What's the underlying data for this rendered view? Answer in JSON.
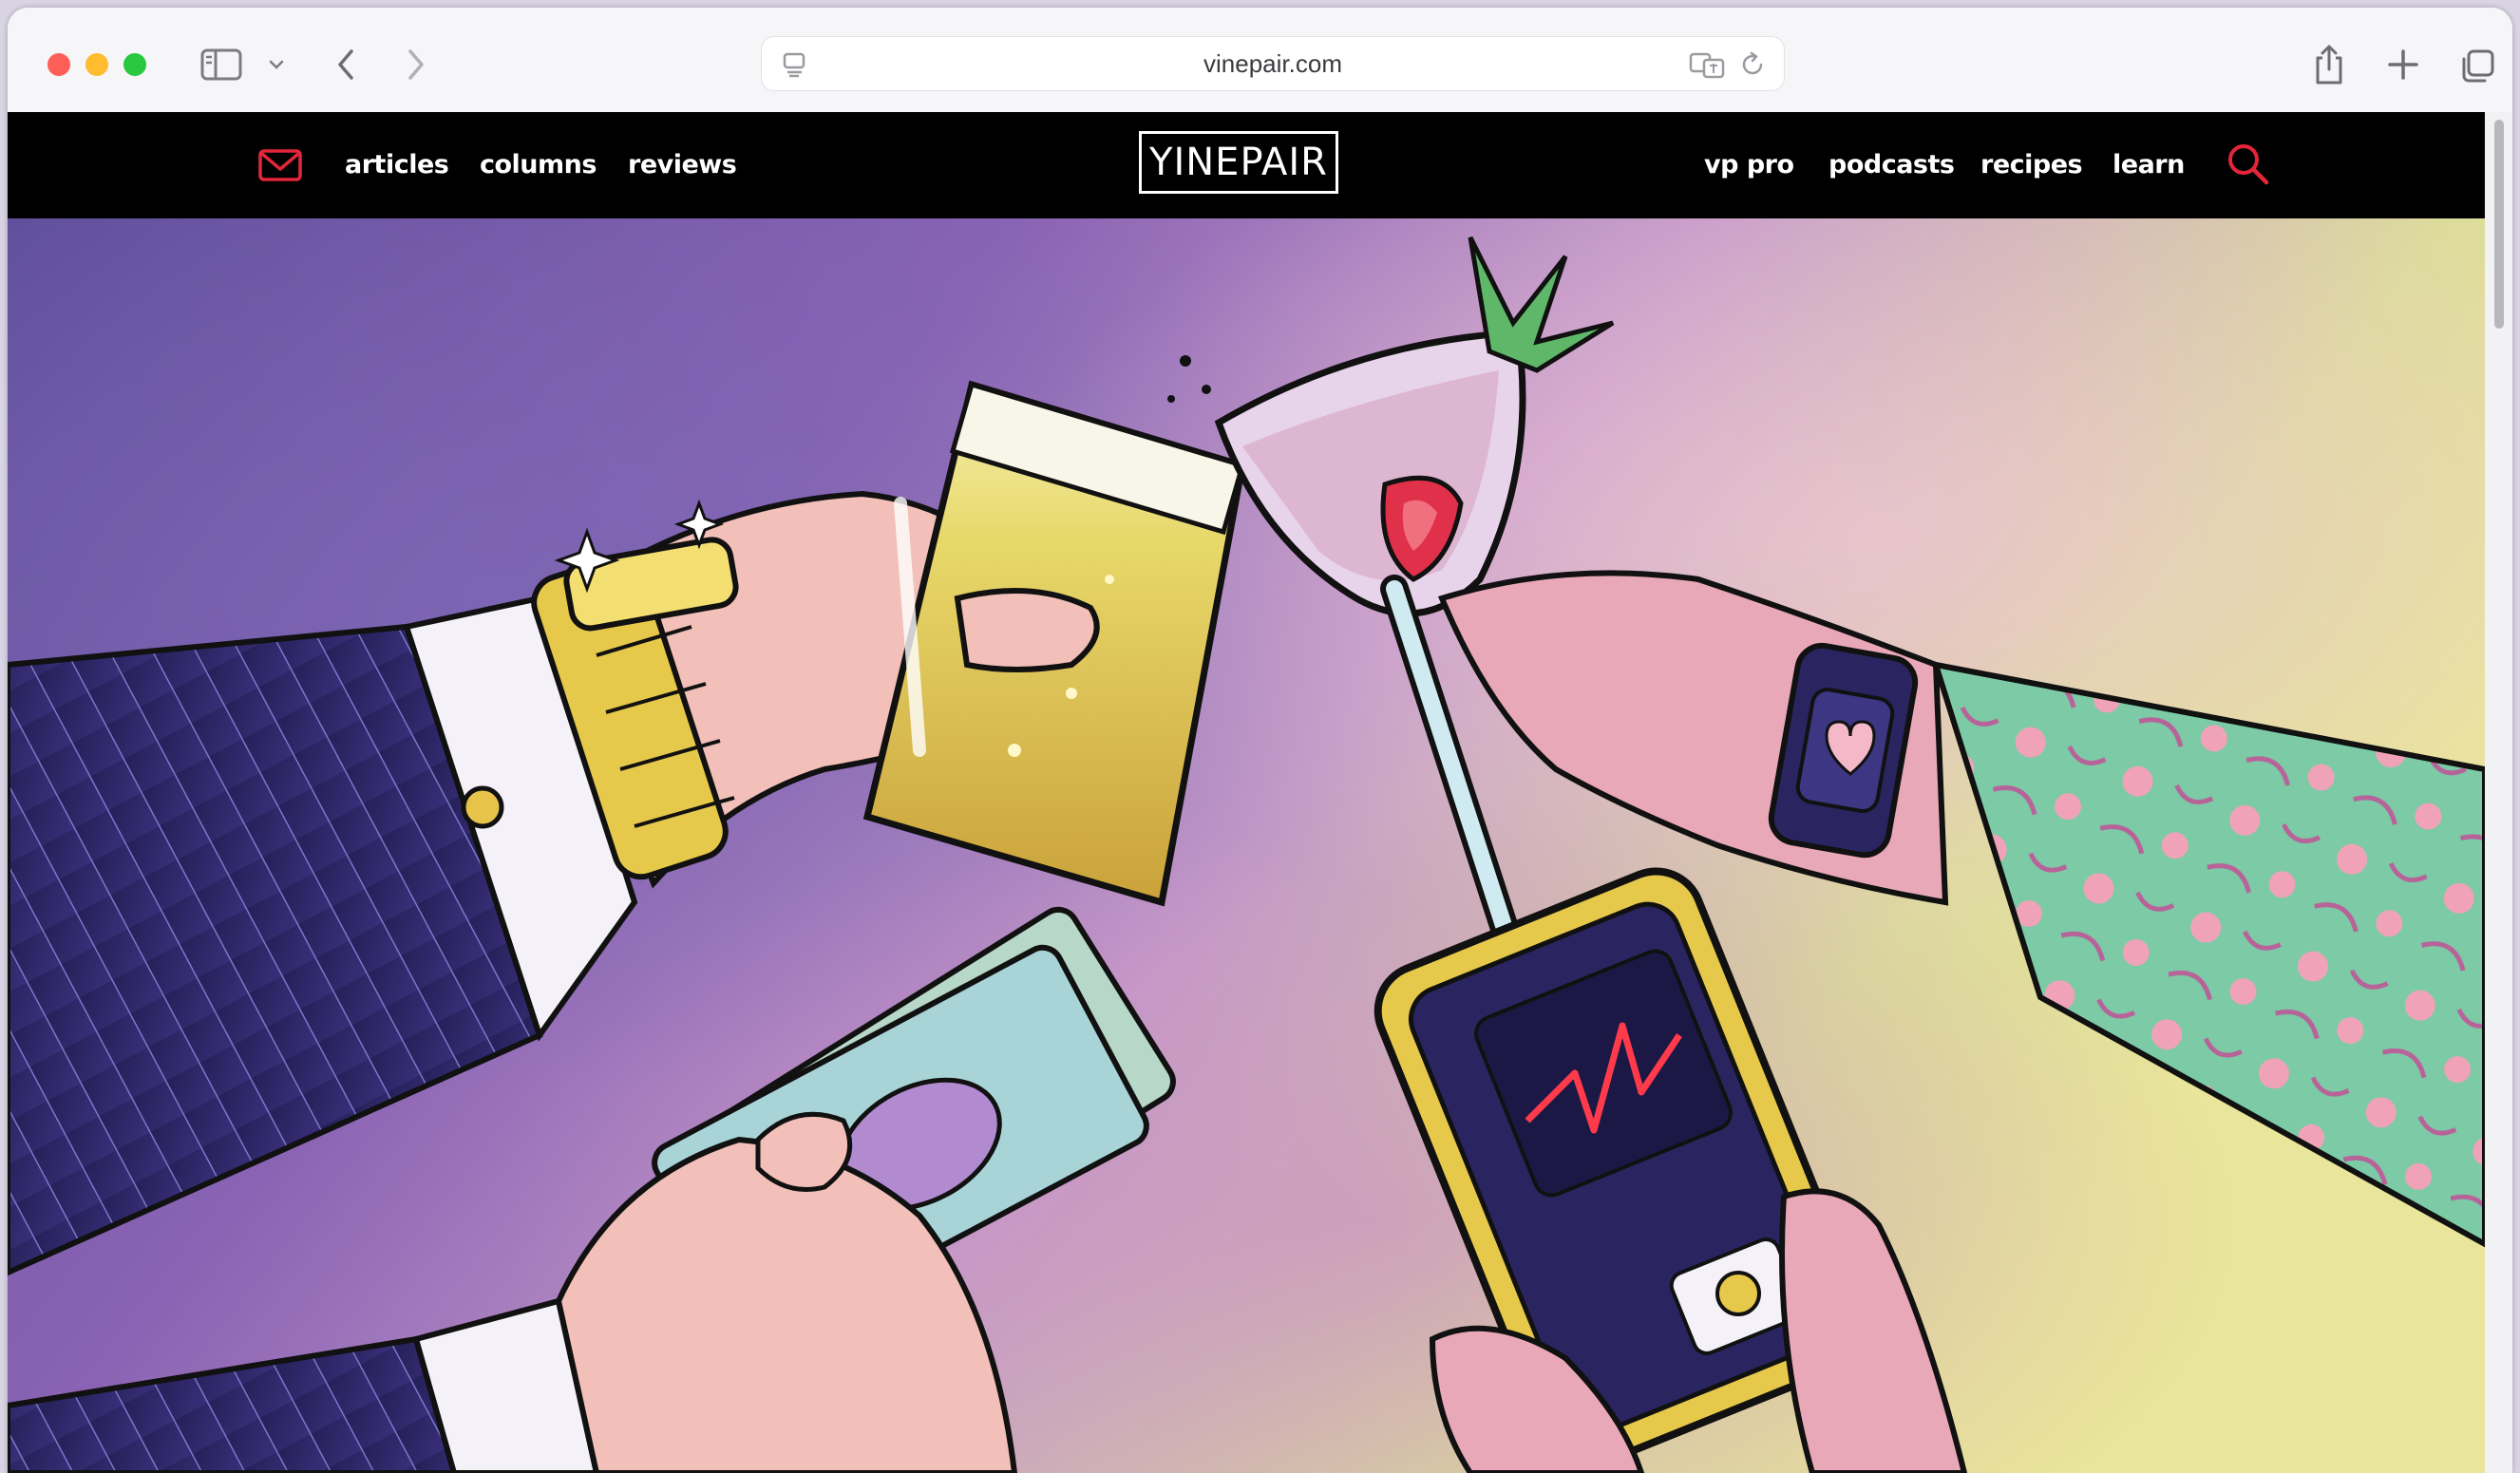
{
  "browser": {
    "url": "vinepair.com",
    "colors": {
      "close": "#fe5f57",
      "minimize": "#febc2e",
      "maximize": "#28c840"
    }
  },
  "site": {
    "logo": "YINEPAIR",
    "nav_left": [
      "articles",
      "columns",
      "reviews"
    ],
    "nav_right": [
      "vp pro",
      "podcasts",
      "recipes",
      "learn"
    ],
    "accent": "#e4263a"
  }
}
